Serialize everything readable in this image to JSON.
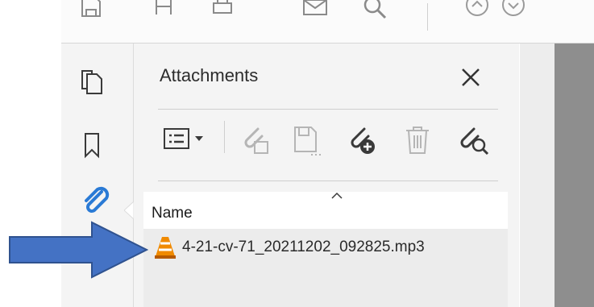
{
  "colors": {
    "accent": "#2a7ad5",
    "arrow": "#4472c4",
    "vlc_orange": "#f08a00"
  },
  "toolbar": {
    "icons": [
      "save-icon",
      "convert-icon",
      "print-icon",
      "email-icon",
      "search-icon",
      "page-up-icon",
      "page-down-icon"
    ]
  },
  "navrail": {
    "icons": [
      "pages-icon",
      "bookmark-icon",
      "attachment-icon"
    ],
    "active": "attachment-icon"
  },
  "panel": {
    "title": "Attachments",
    "tools": [
      "options-menu-icon",
      "open-attachment-icon",
      "save-attachment-icon",
      "add-attachment-icon",
      "delete-attachment-icon",
      "search-attachment-icon"
    ],
    "list": {
      "column_header": "Name",
      "files": [
        {
          "name": "4-21-cv-71_20211202_092825.mp3",
          "icon": "vlc-icon"
        }
      ]
    }
  }
}
